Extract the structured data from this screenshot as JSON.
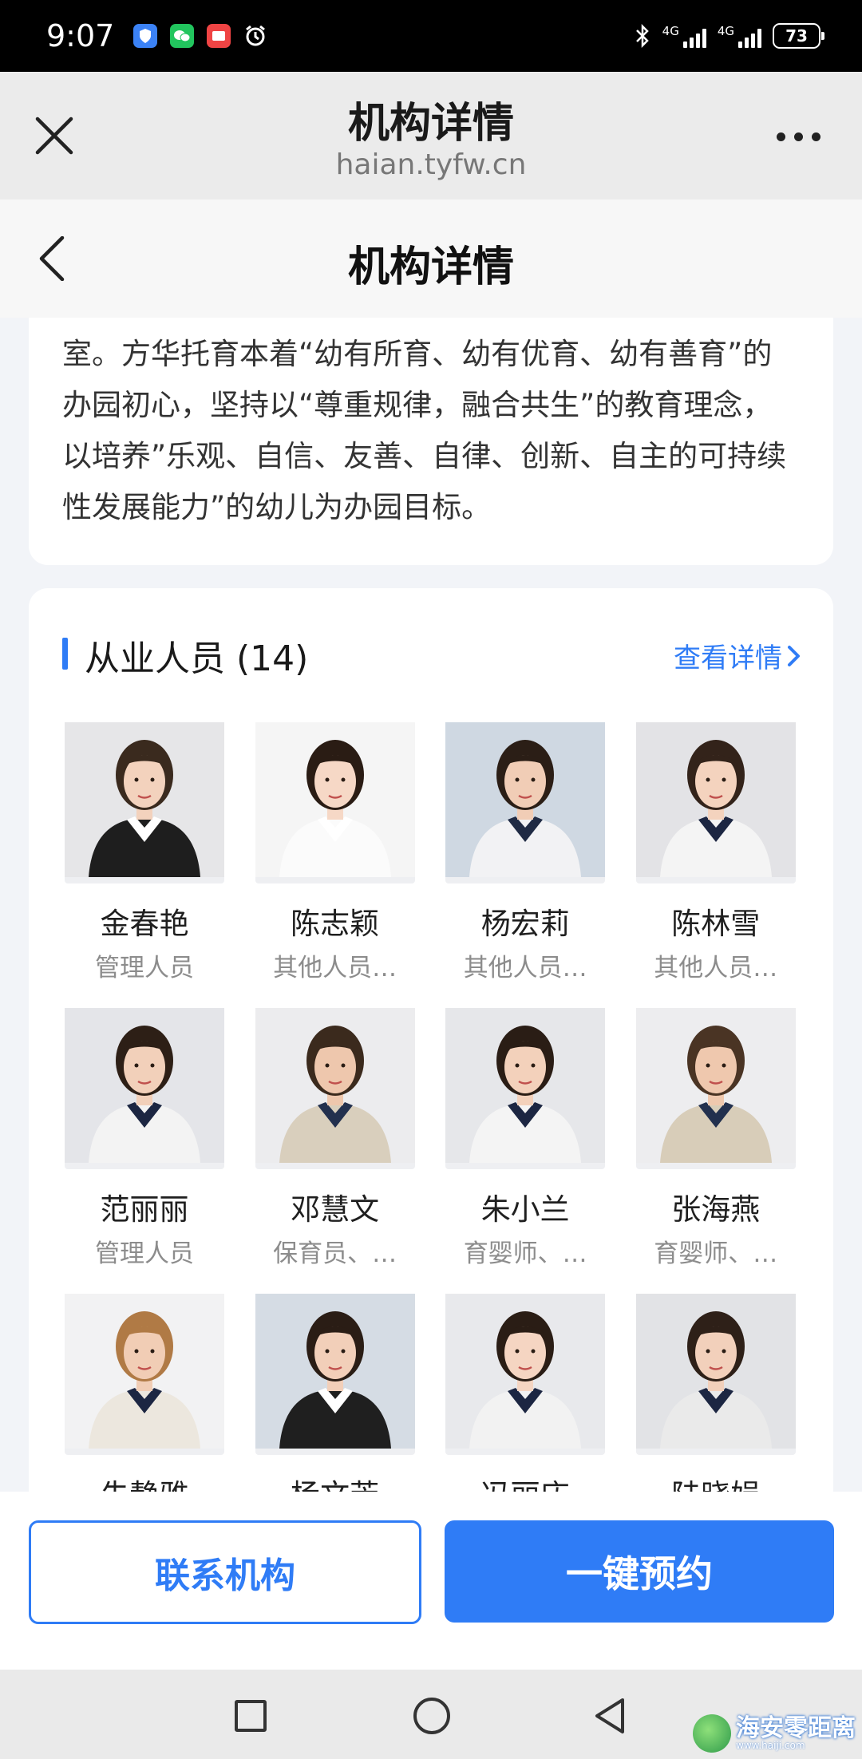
{
  "status_bar": {
    "time": "9:07",
    "app_icons": [
      {
        "icon": "shield-icon",
        "color": "#3b82f6"
      },
      {
        "icon": "wechat-icon",
        "color": "#22c55e"
      },
      {
        "icon": "message-icon",
        "color": "#ef4444"
      },
      {
        "icon": "alarm-icon",
        "color": "#ffffff"
      }
    ],
    "network_1": "4G",
    "network_2": "4G",
    "battery": "73"
  },
  "browser": {
    "title": "机构详情",
    "url": "haian.tyfw.cn"
  },
  "header": {
    "title": "机构详情"
  },
  "intro": {
    "text": "室。方华托育本着“幼有所育、幼有优育、幼有善育”的办园初心，坚持以“尊重规律，融合共生”的教育理念，以培养”乐观、自信、友善、自律、创新、自主的可持续性发展能力”的幼儿为办园目标。"
  },
  "staff": {
    "title": "从业人员 (14)",
    "view_details": "查看详情",
    "members": [
      {
        "name": "金春艳",
        "role": "管理人员",
        "bg": "#e6e6e8",
        "hair": "#3a2a1e",
        "shirt": "#1e1e1e",
        "collar": "#ffffff",
        "skin": "#f3d2bd"
      },
      {
        "name": "陈志颖",
        "role": "其他人员…",
        "bg": "#f5f5f5",
        "hair": "#2a1c14",
        "shirt": "#fbfbfb",
        "collar": "#ffffff",
        "skin": "#f6d8c6"
      },
      {
        "name": "杨宏莉",
        "role": "其他人员…",
        "bg": "#cfd8e2",
        "hair": "#2b1e16",
        "shirt": "#f2f2f4",
        "collar": "#1f2a44",
        "skin": "#f1cdb6"
      },
      {
        "name": "陈林雪",
        "role": "其他人员…",
        "bg": "#e3e3e6",
        "hair": "#33231a",
        "shirt": "#f4f4f4",
        "collar": "#1c2642",
        "skin": "#f4d3be"
      },
      {
        "name": "范丽丽",
        "role": "管理人员",
        "bg": "#e4e5e9",
        "hair": "#2d1f16",
        "shirt": "#f3f3f3",
        "collar": "#1c2642",
        "skin": "#f2d0ba"
      },
      {
        "name": "邓慧文",
        "role": "保育员、…",
        "bg": "#ececee",
        "hair": "#3b2a1d",
        "shirt": "#d9cfbd",
        "collar": "#22304e",
        "skin": "#eec7ad"
      },
      {
        "name": "朱小兰",
        "role": "育婴师、…",
        "bg": "#e6e7ea",
        "hair": "#2a1d15",
        "shirt": "#f4f4f4",
        "collar": "#1c2642",
        "skin": "#f3d1bb"
      },
      {
        "name": "张海燕",
        "role": "育婴师、…",
        "bg": "#ededef",
        "hair": "#4a3424",
        "shirt": "#d8cdb9",
        "collar": "#22304e",
        "skin": "#efc8ae"
      },
      {
        "name": "朱静雅",
        "role": "",
        "bg": "#f2f2f3",
        "hair": "#b07a45",
        "shirt": "#ece7de",
        "collar": "#1c2642",
        "skin": "#f1cdb5"
      },
      {
        "name": "杨文芳",
        "role": "",
        "bg": "#d5dce4",
        "hair": "#2a1d15",
        "shirt": "#1f1f1f",
        "collar": "#ffffff",
        "skin": "#f2cfb9"
      },
      {
        "name": "冯丽庆",
        "role": "",
        "bg": "#e8e9ec",
        "hair": "#2a1d15",
        "shirt": "#f2f2f2",
        "collar": "#1c2642",
        "skin": "#f5d5c2"
      },
      {
        "name": "陆晓娟",
        "role": "",
        "bg": "#e2e3e6",
        "hair": "#2e2018",
        "shirt": "#eaeaea",
        "collar": "#1c2642",
        "skin": "#f2d0bb"
      }
    ]
  },
  "actions": {
    "contact": "联系机构",
    "book": "一键预约"
  },
  "watermark": {
    "main": "海安零距离",
    "sub": "www.haiji.com"
  }
}
